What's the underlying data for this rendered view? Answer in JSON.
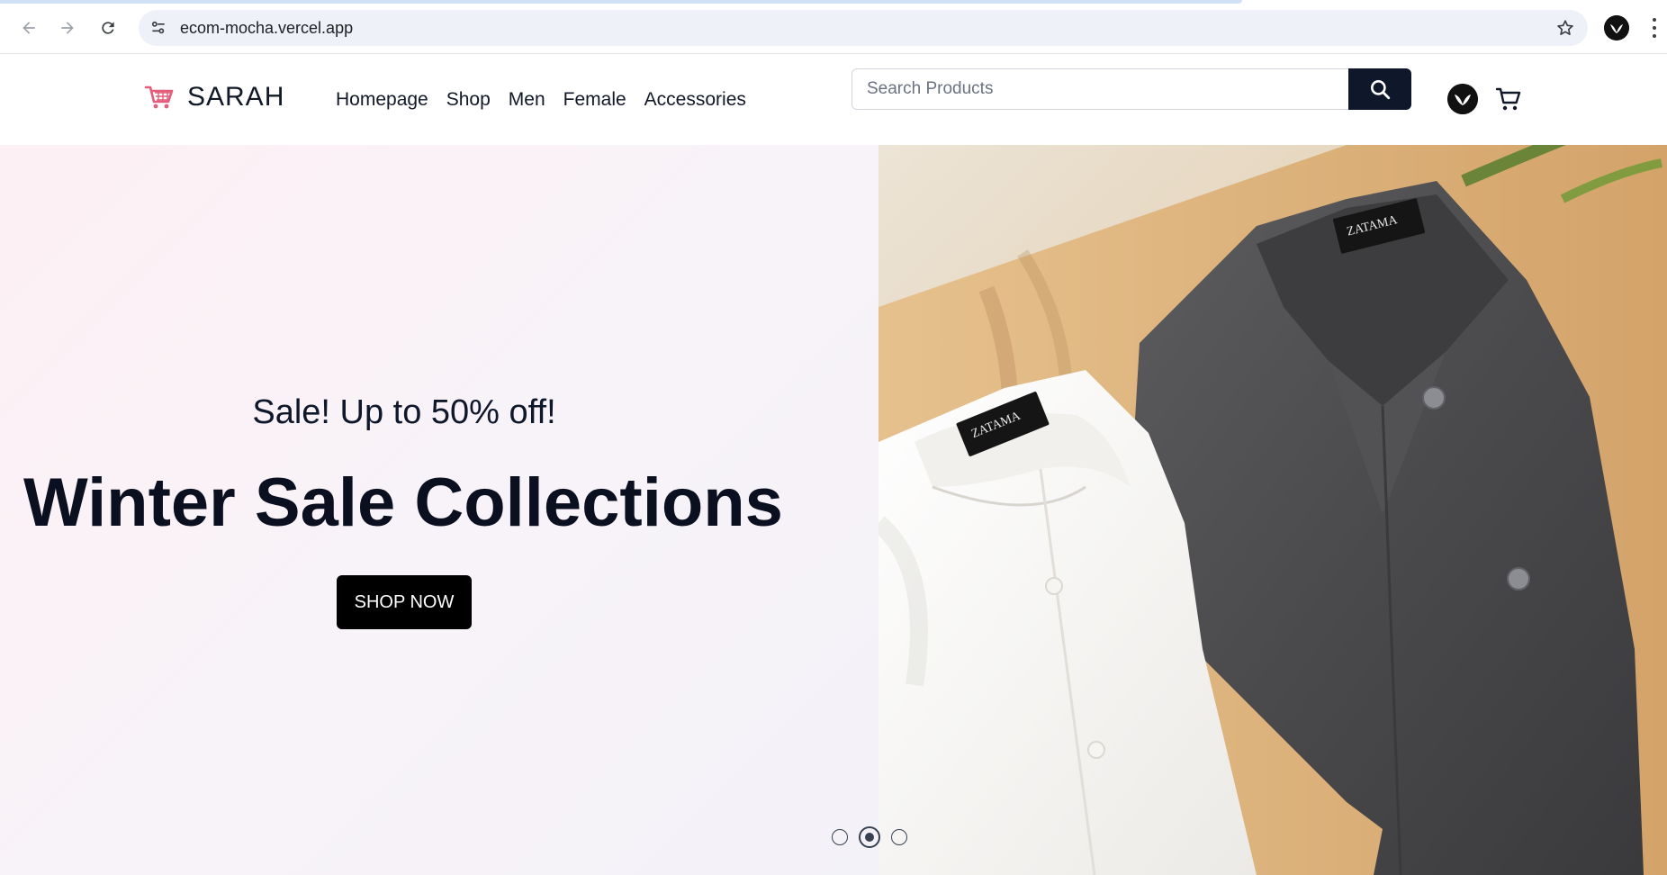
{
  "browser": {
    "url": "ecom-mocha.vercel.app",
    "icons": [
      "back-icon",
      "forward-icon",
      "reload-icon",
      "site-info-icon",
      "bookmark-star-icon",
      "profile-avatar-icon",
      "more-menu-icon"
    ]
  },
  "header": {
    "brand_name": "SARAH",
    "nav": [
      {
        "label": "Homepage"
      },
      {
        "label": "Shop"
      },
      {
        "label": "Men"
      },
      {
        "label": "Female"
      },
      {
        "label": "Accessories"
      }
    ],
    "search": {
      "placeholder": "Search Products",
      "value": ""
    },
    "icons": [
      "cart-logo-icon",
      "search-icon",
      "user-avatar-icon",
      "cart-icon"
    ]
  },
  "hero": {
    "kicker": "Sale! Up to 50% off!",
    "title": "Winter Sale Collections",
    "cta_label": "SHOP NOW",
    "slides_total": 3,
    "active_slide": 2,
    "image_labels": [
      "ZATAMA",
      "ZATAMA"
    ]
  },
  "colors": {
    "primary_dark": "#0f172a",
    "cta_bg": "#000000",
    "brand_icon": "#e35d7a",
    "hero_bg": "#f8f3f8"
  }
}
